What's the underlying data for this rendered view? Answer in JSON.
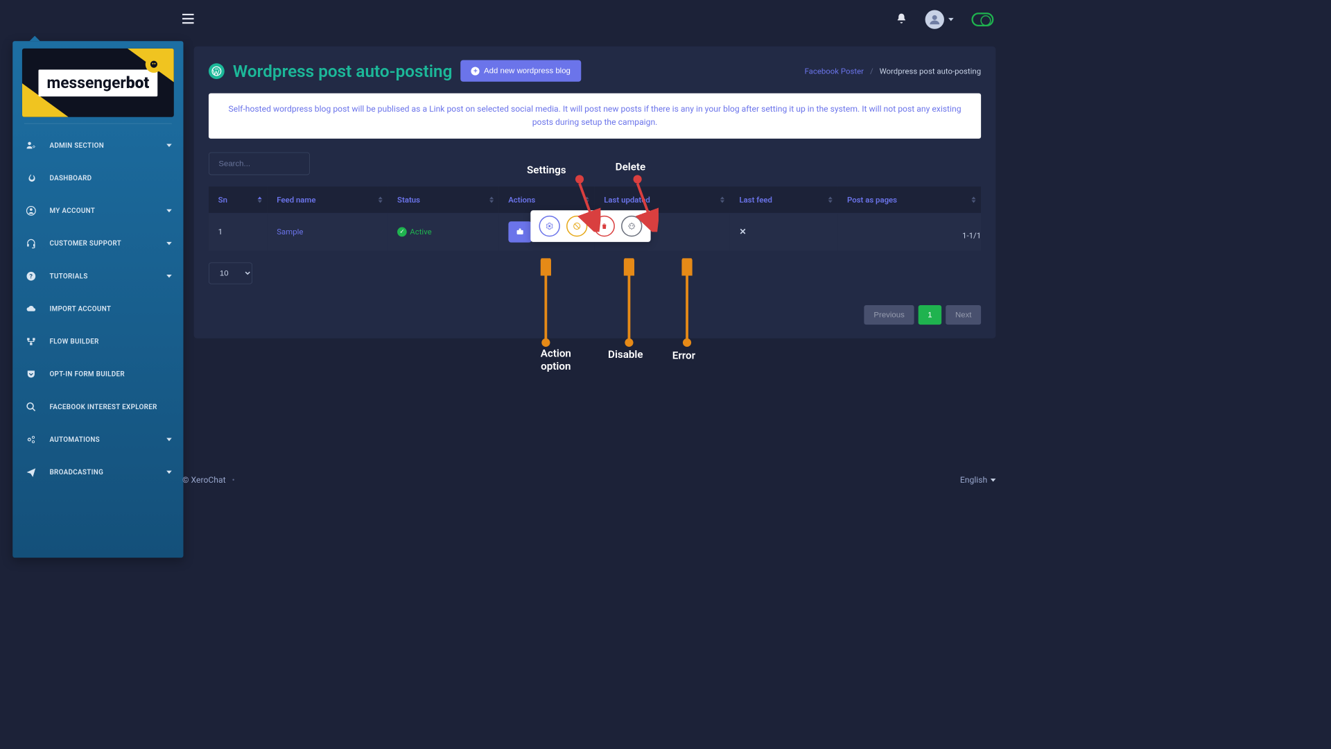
{
  "topbar": {
    "language": "English"
  },
  "sidebar": {
    "logo_text": "messenger",
    "logo_bold": "bot",
    "items": [
      {
        "label": "ADMIN SECTION",
        "has_chevron": true,
        "icon": "users-cog"
      },
      {
        "label": "DASHBOARD",
        "has_chevron": false,
        "icon": "flame"
      },
      {
        "label": "MY ACCOUNT",
        "has_chevron": true,
        "icon": "user-circle"
      },
      {
        "label": "CUSTOMER SUPPORT",
        "has_chevron": true,
        "icon": "headset"
      },
      {
        "label": "TUTORIALS",
        "has_chevron": true,
        "icon": "question"
      },
      {
        "label": "IMPORT ACCOUNT",
        "has_chevron": false,
        "icon": "cloud"
      },
      {
        "label": "FLOW BUILDER",
        "has_chevron": false,
        "icon": "flow"
      },
      {
        "label": "OPT-IN FORM BUILDER",
        "has_chevron": false,
        "icon": "pocket"
      },
      {
        "label": "FACEBOOK INTEREST EXPLORER",
        "has_chevron": false,
        "icon": "search"
      },
      {
        "label": "AUTOMATIONS",
        "has_chevron": true,
        "icon": "cogs"
      },
      {
        "label": "BROADCASTING",
        "has_chevron": true,
        "icon": "send"
      }
    ]
  },
  "page": {
    "title": "Wordpress post auto-posting",
    "add_button": "Add new wordpress blog",
    "breadcrumb_parent": "Facebook Poster",
    "breadcrumb_current": "Wordpress post auto-posting",
    "info": "Self-hosted wordpress blog post will be publised as a Link post on selected social media. It will post new posts if there is any in your blog after setting it up in the system. It will not post any existing posts during setup the campaign.",
    "search_placeholder": "Search...",
    "columns": [
      "Sn",
      "Feed name",
      "Status",
      "Actions",
      "Last updated",
      "Last feed",
      "Post as pages"
    ],
    "row": {
      "sn": "1",
      "feed": "Sample",
      "status": "Active",
      "last_updated": "",
      "last_feed": "",
      "post_pages": "✕"
    },
    "page_size": "10",
    "page_info": "1-1/1",
    "prev": "Previous",
    "page_num": "1",
    "next": "Next"
  },
  "footer": {
    "copy": "© XeroChat",
    "lang": "English"
  },
  "anno": {
    "settings": "Settings",
    "delete": "Delete",
    "action_option": "Action option",
    "disable": "Disable",
    "error": "Error"
  }
}
